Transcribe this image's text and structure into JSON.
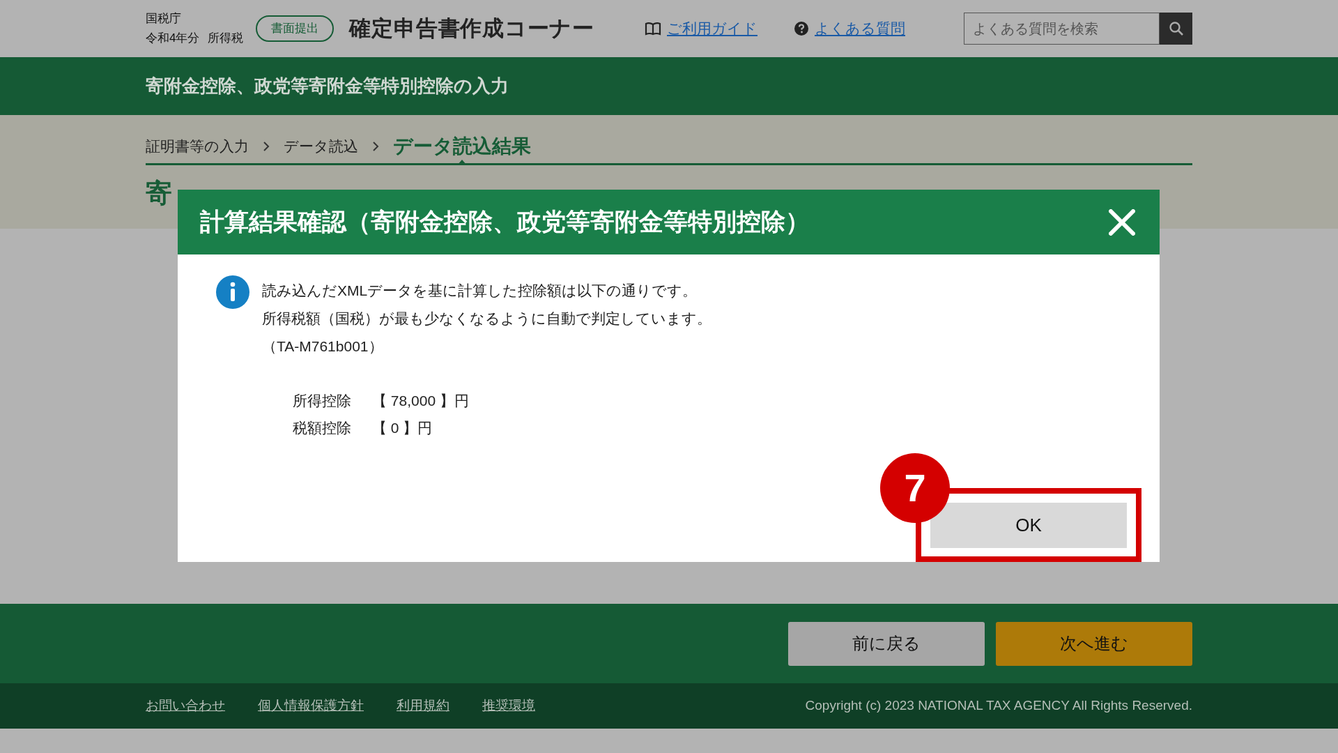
{
  "header": {
    "agency": "国税庁",
    "year": "令和4年分",
    "tax": "所得税",
    "badge": "書面提出",
    "title": "確定申告書作成コーナー",
    "links": [
      {
        "label": "ご利用ガイド",
        "kind": "guide"
      },
      {
        "label": "よくある質問",
        "kind": "faq"
      }
    ],
    "search": {
      "placeholder": "よくある質問を検索"
    }
  },
  "section_title": "寄附金控除、政党等寄附金等特別控除の入力",
  "breadcrumb": [
    {
      "label": "証明書等の入力",
      "selected": false
    },
    {
      "label": "データ読込",
      "selected": false
    },
    {
      "label": "データ読込結果",
      "selected": true
    }
  ],
  "page_heading": "寄",
  "dialog": {
    "title": "計算結果確認（寄附金控除、政党等寄附金等特別控除）",
    "message": [
      "読み込んだXMLデータを基に計算した控除額は以下の通りです。",
      "所得税額（国税）が最も少なくなるように自動で判定しています。",
      "（TA-M761b001）"
    ],
    "amounts": [
      {
        "label": "所得控除",
        "value": "【 78,000 】円"
      },
      {
        "label": "税額控除",
        "value": "【 0 】円"
      }
    ],
    "ok_button": "OK",
    "step_badge": "7"
  },
  "nav_buttons": [
    {
      "label": "前に戻る",
      "kind": "back"
    },
    {
      "label": "次へ進む",
      "kind": "next"
    }
  ],
  "footer": {
    "links": [
      "お問い合わせ",
      "個人情報保護方針",
      "利用規約",
      "推奨環境"
    ],
    "copyright": "Copyright (c) 2023 NATIONAL TAX AGENCY All Rights Reserved."
  }
}
